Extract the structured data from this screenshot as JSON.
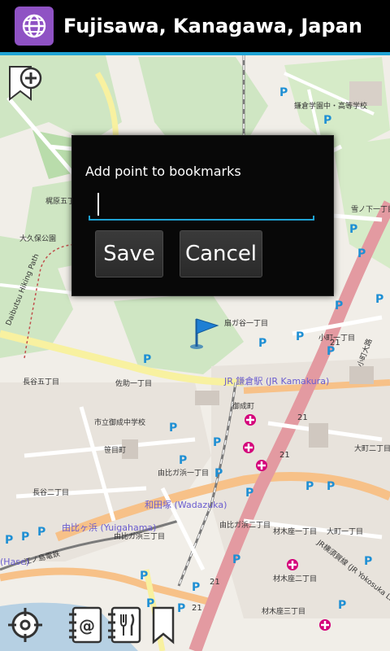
{
  "app": {
    "title": "Fujisawa, Kanagawa, Japan",
    "icon": "globe-icon",
    "accent_color": "#1fa3d4",
    "icon_bg_color": "#8f52c4"
  },
  "map": {
    "parking_symbol": "P",
    "area_labels": [
      "鎌倉学園中・高等学校",
      "梶原五丁目",
      "大久保公園",
      "Daibutsu Hiking Path",
      "扇ガ谷一丁目",
      "佐助一丁目",
      "長谷五丁目",
      "御成町",
      "市立御成中学校",
      "笹目町",
      "由比ガ浜一丁目",
      "長谷二丁目",
      "由比ガ浜三丁目",
      "由比ガ浜二丁目",
      "材木座一丁目",
      "材木座二丁目",
      "材木座三丁目",
      "大町一丁目",
      "大町二丁目",
      "小町一丁目",
      "小町大路",
      "雪ノ下一丁目",
      "JR横須賀線 (JR Yokosuka Line)",
      "江ノ島電鉄"
    ],
    "stations": [
      "JR 鎌倉駅 (JR Kamakura)",
      "和田塚 (Wadazuka)",
      "由比ヶ浜 (Yuigahama)",
      "(Hase)"
    ],
    "road_numbers": [
      "21",
      "21",
      "21",
      "21",
      "21"
    ],
    "marker": "blue-flag-icon"
  },
  "buttons": {
    "add_bookmark": "add-bookmark-icon"
  },
  "toolbar": {
    "items": [
      {
        "icon": "my-location-icon"
      },
      {
        "icon": "contact-at-icon"
      },
      {
        "icon": "restaurant-icon"
      },
      {
        "icon": "bookmark-icon"
      }
    ]
  },
  "dialog": {
    "title": "Add point to bookmarks",
    "input_value": "",
    "save_label": "Save",
    "cancel_label": "Cancel"
  }
}
